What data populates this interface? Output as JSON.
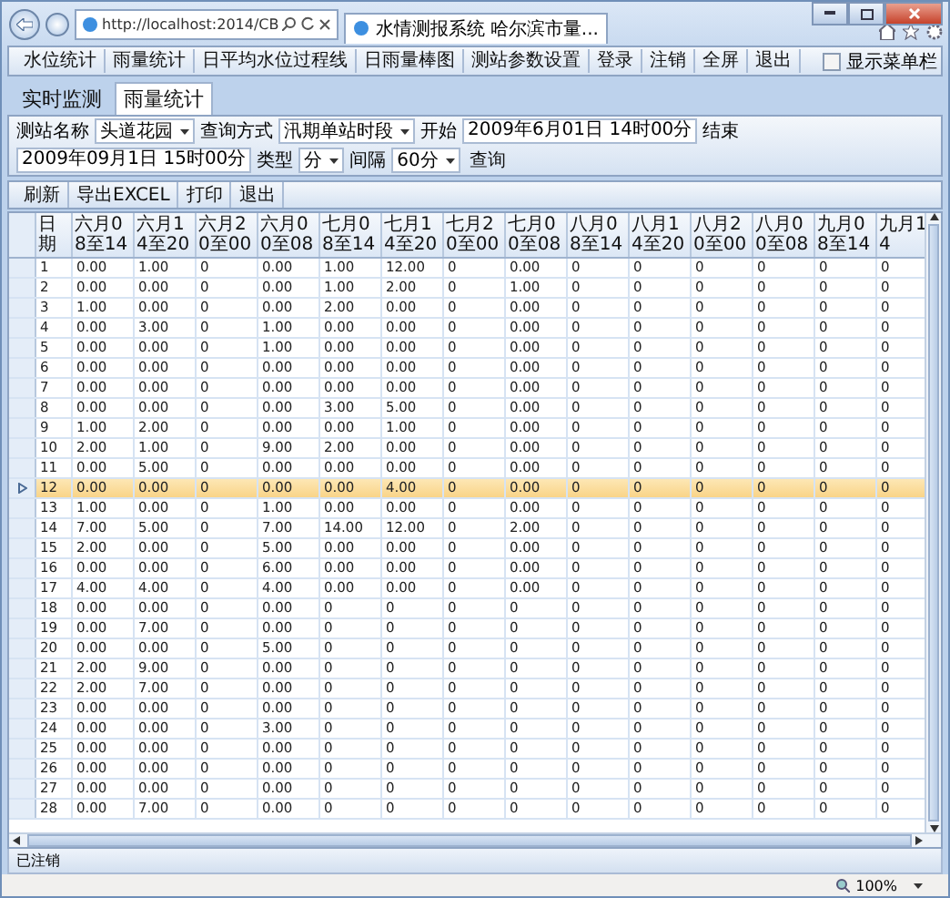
{
  "browser": {
    "address": "http://localhost:2014/CB",
    "tab_title": "水情测报系统 哈尔滨市量..."
  },
  "menu": {
    "items": [
      "水位统计",
      "雨量统计",
      "日平均水位过程线",
      "日雨量棒图",
      "测站参数设置",
      "登录",
      "注销",
      "全屏",
      "退出"
    ],
    "checkbox": {
      "label": "显示菜单栏",
      "checked": false
    }
  },
  "tabs": [
    {
      "label": "实时监测",
      "selected": false
    },
    {
      "label": "雨量统计",
      "selected": true
    }
  ],
  "filters": [
    {
      "kind": "label",
      "text": "测站名称"
    },
    {
      "kind": "select",
      "value": "头道花园"
    },
    {
      "kind": "label",
      "text": "查询方式"
    },
    {
      "kind": "select",
      "value": "汛期单站时段"
    },
    {
      "kind": "label",
      "text": "开始"
    },
    {
      "kind": "field",
      "value": "2009年6月01日 14时00分"
    },
    {
      "kind": "label",
      "text": "结束"
    },
    {
      "kind": "field",
      "value": "2009年09月1日 15时00分"
    },
    {
      "kind": "label",
      "text": "类型"
    },
    {
      "kind": "select",
      "value": "分"
    },
    {
      "kind": "label",
      "text": "间隔"
    },
    {
      "kind": "select",
      "value": "60分"
    },
    {
      "kind": "button",
      "text": "查询"
    }
  ],
  "toolbar": [
    "刷新",
    "导出EXCEL",
    "打印",
    "退出"
  ],
  "table": {
    "columns": [
      "日期",
      "六月08至14",
      "六月14至20",
      "六月20至00",
      "六月00至08",
      "七月08至14",
      "七月14至20",
      "七月20至00",
      "七月00至08",
      "八月08至14",
      "八月14至20",
      "八月20至00",
      "八月00至08",
      "九月08至14",
      "九月14"
    ],
    "rows": [
      {
        "selected": false,
        "cells": [
          "1",
          "0.00",
          "1.00",
          "0",
          "0.00",
          "1.00",
          "12.00",
          "0",
          "0.00",
          "0",
          "0",
          "0",
          "0",
          "0",
          "0"
        ]
      },
      {
        "selected": false,
        "cells": [
          "2",
          "0.00",
          "0.00",
          "0",
          "0.00",
          "1.00",
          "2.00",
          "0",
          "1.00",
          "0",
          "0",
          "0",
          "0",
          "0",
          "0"
        ]
      },
      {
        "selected": false,
        "cells": [
          "3",
          "1.00",
          "0.00",
          "0",
          "0.00",
          "2.00",
          "0.00",
          "0",
          "0.00",
          "0",
          "0",
          "0",
          "0",
          "0",
          "0"
        ]
      },
      {
        "selected": false,
        "cells": [
          "4",
          "0.00",
          "3.00",
          "0",
          "1.00",
          "0.00",
          "0.00",
          "0",
          "0.00",
          "0",
          "0",
          "0",
          "0",
          "0",
          "0"
        ]
      },
      {
        "selected": false,
        "cells": [
          "5",
          "0.00",
          "0.00",
          "0",
          "1.00",
          "0.00",
          "0.00",
          "0",
          "0.00",
          "0",
          "0",
          "0",
          "0",
          "0",
          "0"
        ]
      },
      {
        "selected": false,
        "cells": [
          "6",
          "0.00",
          "0.00",
          "0",
          "0.00",
          "0.00",
          "0.00",
          "0",
          "0.00",
          "0",
          "0",
          "0",
          "0",
          "0",
          "0"
        ]
      },
      {
        "selected": false,
        "cells": [
          "7",
          "0.00",
          "0.00",
          "0",
          "0.00",
          "0.00",
          "0.00",
          "0",
          "0.00",
          "0",
          "0",
          "0",
          "0",
          "0",
          "0"
        ]
      },
      {
        "selected": false,
        "cells": [
          "8",
          "0.00",
          "0.00",
          "0",
          "0.00",
          "3.00",
          "5.00",
          "0",
          "0.00",
          "0",
          "0",
          "0",
          "0",
          "0",
          "0"
        ]
      },
      {
        "selected": false,
        "cells": [
          "9",
          "1.00",
          "2.00",
          "0",
          "0.00",
          "0.00",
          "1.00",
          "0",
          "0.00",
          "0",
          "0",
          "0",
          "0",
          "0",
          "0"
        ]
      },
      {
        "selected": false,
        "cells": [
          "10",
          "2.00",
          "1.00",
          "0",
          "9.00",
          "2.00",
          "0.00",
          "0",
          "0.00",
          "0",
          "0",
          "0",
          "0",
          "0",
          "0"
        ]
      },
      {
        "selected": false,
        "cells": [
          "11",
          "0.00",
          "5.00",
          "0",
          "0.00",
          "0.00",
          "0.00",
          "0",
          "0.00",
          "0",
          "0",
          "0",
          "0",
          "0",
          "0"
        ]
      },
      {
        "selected": true,
        "cells": [
          "12",
          "0.00",
          "0.00",
          "0",
          "0.00",
          "0.00",
          "4.00",
          "0",
          "0.00",
          "0",
          "0",
          "0",
          "0",
          "0",
          "0"
        ]
      },
      {
        "selected": false,
        "cells": [
          "13",
          "1.00",
          "0.00",
          "0",
          "1.00",
          "0.00",
          "0.00",
          "0",
          "0.00",
          "0",
          "0",
          "0",
          "0",
          "0",
          "0"
        ]
      },
      {
        "selected": false,
        "cells": [
          "14",
          "7.00",
          "5.00",
          "0",
          "7.00",
          "14.00",
          "12.00",
          "0",
          "2.00",
          "0",
          "0",
          "0",
          "0",
          "0",
          "0"
        ]
      },
      {
        "selected": false,
        "cells": [
          "15",
          "2.00",
          "0.00",
          "0",
          "5.00",
          "0.00",
          "0.00",
          "0",
          "0.00",
          "0",
          "0",
          "0",
          "0",
          "0",
          "0"
        ]
      },
      {
        "selected": false,
        "cells": [
          "16",
          "0.00",
          "0.00",
          "0",
          "6.00",
          "0.00",
          "0.00",
          "0",
          "0.00",
          "0",
          "0",
          "0",
          "0",
          "0",
          "0"
        ]
      },
      {
        "selected": false,
        "cells": [
          "17",
          "4.00",
          "4.00",
          "0",
          "4.00",
          "0.00",
          "0.00",
          "0",
          "0.00",
          "0",
          "0",
          "0",
          "0",
          "0",
          "0"
        ]
      },
      {
        "selected": false,
        "cells": [
          "18",
          "0.00",
          "0.00",
          "0",
          "0.00",
          "0",
          "0",
          "0",
          "0",
          "0",
          "0",
          "0",
          "0",
          "0",
          "0"
        ]
      },
      {
        "selected": false,
        "cells": [
          "19",
          "0.00",
          "7.00",
          "0",
          "0.00",
          "0",
          "0",
          "0",
          "0",
          "0",
          "0",
          "0",
          "0",
          "0",
          "0"
        ]
      },
      {
        "selected": false,
        "cells": [
          "20",
          "0.00",
          "0.00",
          "0",
          "5.00",
          "0",
          "0",
          "0",
          "0",
          "0",
          "0",
          "0",
          "0",
          "0",
          "0"
        ]
      },
      {
        "selected": false,
        "cells": [
          "21",
          "2.00",
          "9.00",
          "0",
          "0.00",
          "0",
          "0",
          "0",
          "0",
          "0",
          "0",
          "0",
          "0",
          "0",
          "0"
        ]
      },
      {
        "selected": false,
        "cells": [
          "22",
          "2.00",
          "7.00",
          "0",
          "0.00",
          "0",
          "0",
          "0",
          "0",
          "0",
          "0",
          "0",
          "0",
          "0",
          "0"
        ]
      },
      {
        "selected": false,
        "cells": [
          "23",
          "0.00",
          "0.00",
          "0",
          "0.00",
          "0",
          "0",
          "0",
          "0",
          "0",
          "0",
          "0",
          "0",
          "0",
          "0"
        ]
      },
      {
        "selected": false,
        "cells": [
          "24",
          "0.00",
          "0.00",
          "0",
          "3.00",
          "0",
          "0",
          "0",
          "0",
          "0",
          "0",
          "0",
          "0",
          "0",
          "0"
        ]
      },
      {
        "selected": false,
        "cells": [
          "25",
          "0.00",
          "0.00",
          "0",
          "0.00",
          "0",
          "0",
          "0",
          "0",
          "0",
          "0",
          "0",
          "0",
          "0",
          "0"
        ]
      },
      {
        "selected": false,
        "cells": [
          "26",
          "0.00",
          "0.00",
          "0",
          "0.00",
          "0",
          "0",
          "0",
          "0",
          "0",
          "0",
          "0",
          "0",
          "0",
          "0"
        ]
      },
      {
        "selected": false,
        "cells": [
          "27",
          "0.00",
          "0.00",
          "0",
          "0.00",
          "0",
          "0",
          "0",
          "0",
          "0",
          "0",
          "0",
          "0",
          "0",
          "0"
        ]
      },
      {
        "selected": false,
        "cells": [
          "28",
          "0.00",
          "7.00",
          "0",
          "0.00",
          "0",
          "0",
          "0",
          "0",
          "0",
          "0",
          "0",
          "0",
          "0",
          "0"
        ]
      }
    ]
  },
  "status_bar": {
    "text": "已注销"
  },
  "zoom": "100%"
}
